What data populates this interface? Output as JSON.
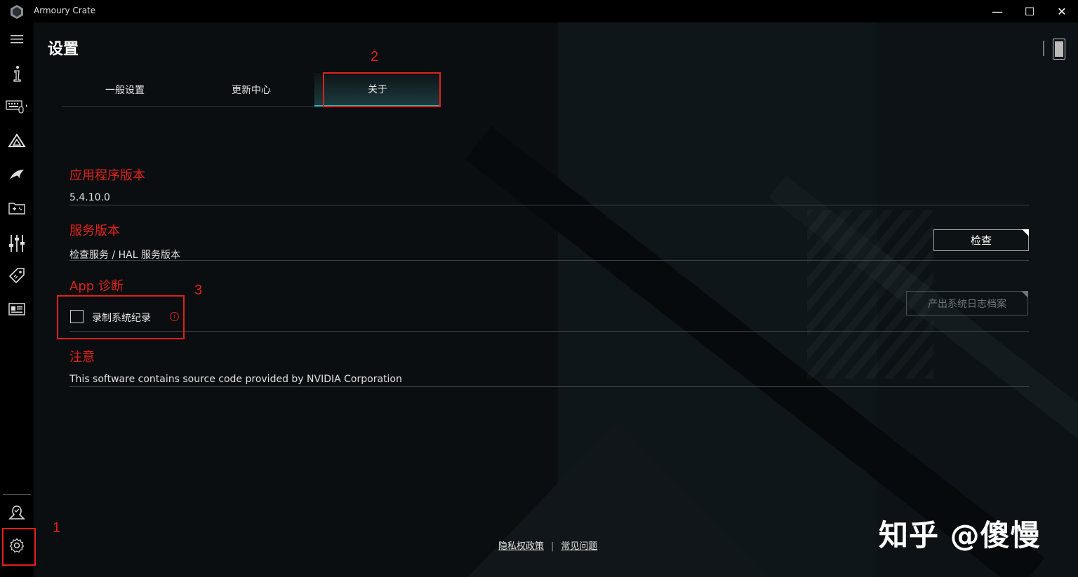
{
  "window": {
    "title": "Armoury Crate",
    "minimize": "—",
    "maximize": "☐",
    "close": "✕"
  },
  "sidebar": {
    "items": [
      {
        "name": "menu-icon"
      },
      {
        "name": "info-icon"
      },
      {
        "name": "keyboard-icon"
      },
      {
        "name": "aura-icon"
      },
      {
        "name": "rog-eye-icon"
      },
      {
        "name": "game-library-icon"
      },
      {
        "name": "equalizer-icon"
      },
      {
        "name": "deals-tag-icon"
      },
      {
        "name": "news-icon"
      },
      {
        "name": "user-icon"
      },
      {
        "name": "gear-icon"
      }
    ]
  },
  "page": {
    "title": "设置",
    "tabs": [
      {
        "label": "一般设置",
        "active": false
      },
      {
        "label": "更新中心",
        "active": false
      },
      {
        "label": "关于",
        "active": true
      }
    ]
  },
  "about": {
    "app_version_title": "应用程序版本",
    "app_version_value": "5.4.10.0",
    "service_version_title": "服务版本",
    "service_version_text": "检查服务 / HAL 服务版本",
    "check_button": "检查",
    "diagnosis_title": "App 诊断",
    "record_log_label": "录制系统纪录",
    "record_log_checked": false,
    "export_log_button": "产出系统日志档案",
    "notice_title": "注意",
    "notice_text": "This software contains source code provided by NVIDIA Corporation"
  },
  "footer": {
    "privacy_policy": "隐私权政策",
    "separator": "|",
    "faq": "常见问题"
  },
  "annotations": {
    "marker_1": "1",
    "marker_2": "2",
    "marker_3": "3"
  },
  "watermark": "知乎 @傻慢",
  "colors": {
    "accent_red": "#e0201a",
    "accent_teal": "#2fb9b1",
    "background": "#0a0e10"
  }
}
